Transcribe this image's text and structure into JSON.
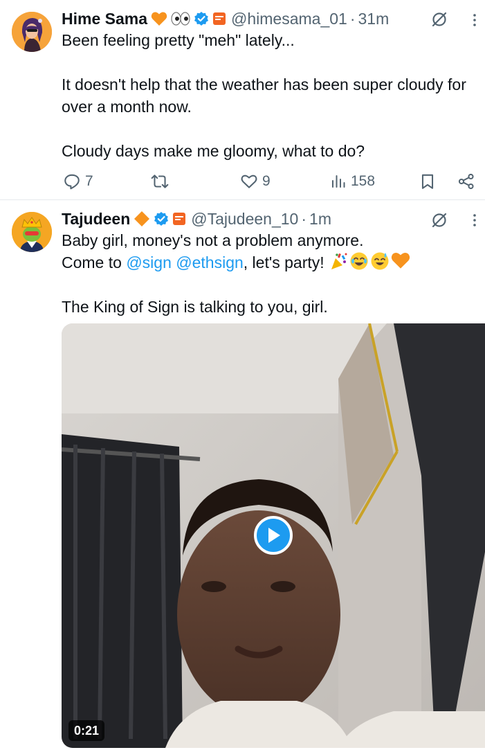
{
  "tweets": [
    {
      "name": "Hime Sama",
      "handle": "@himesama_01",
      "separator": "·",
      "time": "31m",
      "icons": [
        "orange-heart-emoji",
        "eyes-emoji",
        "verified-badge",
        "sign-affiliate-badge"
      ],
      "body": [
        "Been feeling pretty \"meh\" lately...",
        "It doesn't help that the weather has been super cloudy for over a month now.",
        "Cloudy days make me gloomy, what to do?"
      ],
      "actions": {
        "replies": "7",
        "reposts": "",
        "likes": "9",
        "views": "158"
      }
    },
    {
      "name": "Tajudeen",
      "handle": "@Tajudeen_10",
      "separator": "·",
      "time": "1m",
      "icons": [
        "orange-diamond-emoji",
        "verified-badge",
        "sign-affiliate-badge"
      ],
      "body_line1": "Baby girl, money's not a problem anymore.",
      "body_line2_prefix": "Come to ",
      "mention1": "@sign",
      "mention2": "@ethsign",
      "body_line2_suffix": ", let's party! ",
      "body_line2_emojis": [
        "confetti-emoji",
        "laughing-emoji",
        "sweat-smile-emoji",
        "orange-heart-emoji"
      ],
      "body_line3": "The King of Sign is talking to you, girl.",
      "video": {
        "duration": "0:21"
      }
    }
  ],
  "colors": {
    "text": "#0f1419",
    "muted": "#536471",
    "link": "#1d9bf0",
    "verified": "#1d9bf0",
    "heart": "#f7931e",
    "divider": "#e6e9ec"
  }
}
